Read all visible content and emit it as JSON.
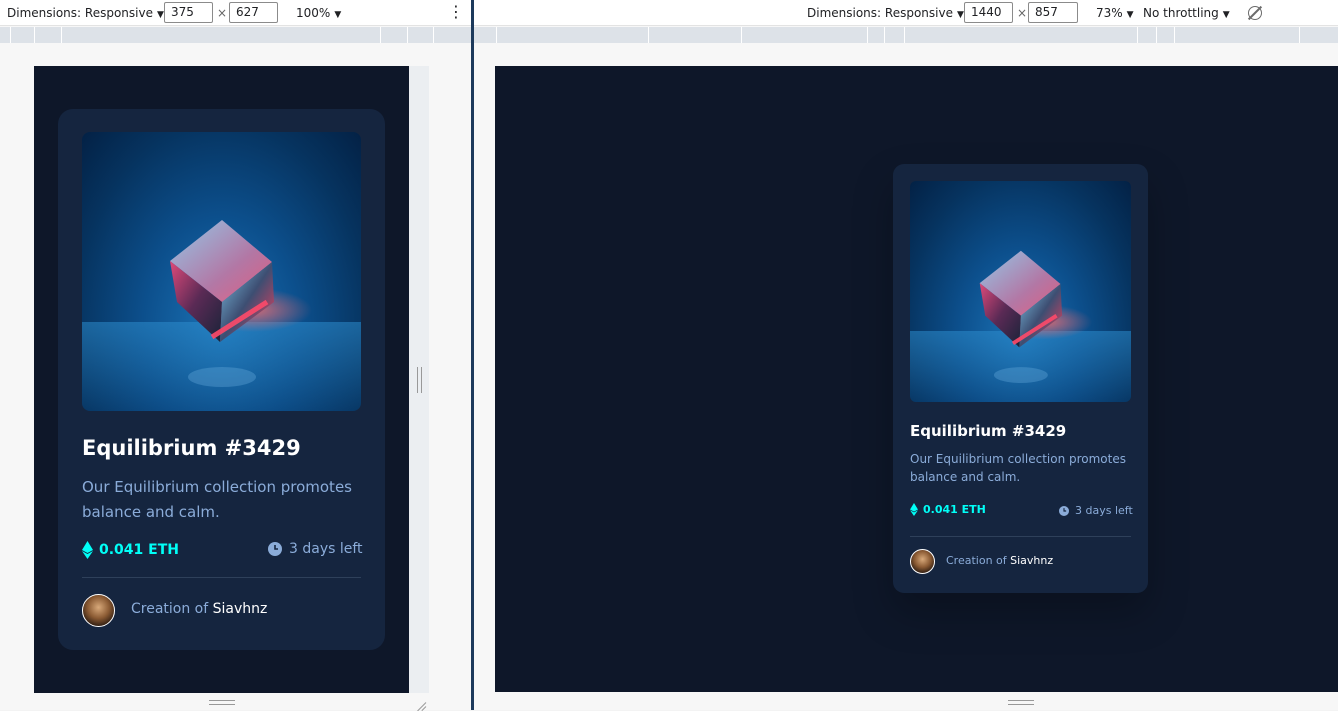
{
  "left": {
    "toolbar": {
      "dimensions_label": "Dimensions: Responsive",
      "width": "375",
      "height": "627",
      "times": "×",
      "zoom": "100%",
      "more": "⋮"
    }
  },
  "right": {
    "toolbar": {
      "dimensions_label": "Dimensions: Responsive",
      "width": "1440",
      "height": "857",
      "times": "×",
      "zoom": "73%",
      "throttling": "No throttling"
    }
  },
  "card": {
    "title": "Equilibrium #3429",
    "description": "Our Equilibrium collection promotes balance and calm.",
    "price": "0.041 ETH",
    "time_left": "3 days left",
    "creation_of": "Creation of",
    "creator": "Siavhnz"
  },
  "icons": {
    "dropdown": "▼",
    "eth": "ethereum-icon",
    "clock": "clock-icon"
  },
  "colors": {
    "page_bg": "#0e1729",
    "card_bg": "#15253f",
    "accent": "#00fff7",
    "soft_blue": "#8bacd9",
    "white": "#ffffff",
    "line": "#2e405a"
  }
}
